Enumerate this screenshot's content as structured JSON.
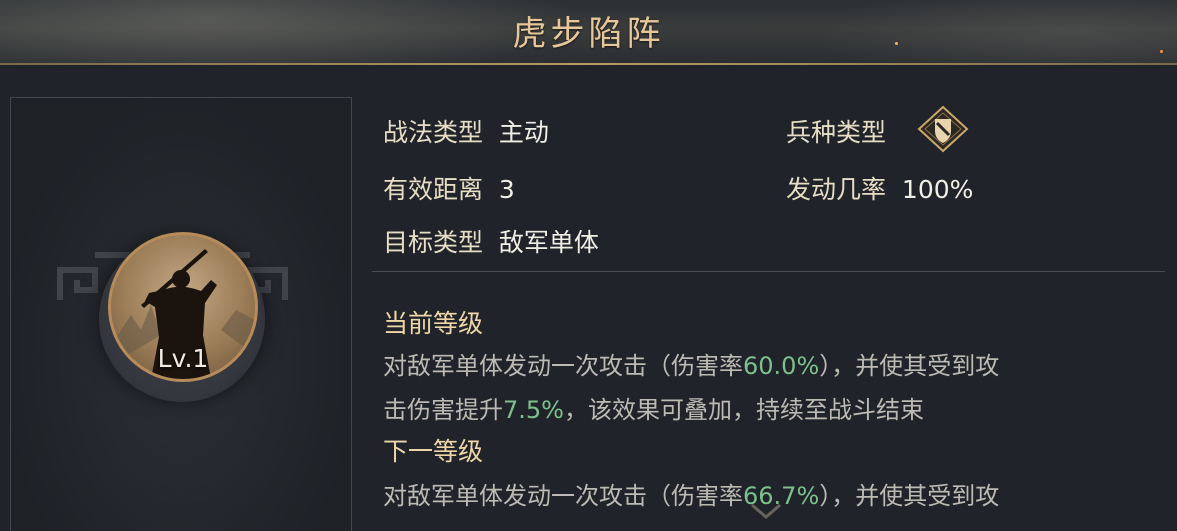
{
  "title": "虎步陷阵",
  "skill": {
    "level": "Lv.1",
    "type_label": "战法类型",
    "type_value": "主动",
    "troop_label": "兵种类型",
    "troop_icon": "shield-icon",
    "range_label": "有效距离",
    "range_value": "3",
    "rate_label": "发动几率",
    "rate_value": "100%",
    "target_label": "目标类型",
    "target_value": "敌军单体"
  },
  "current": {
    "heading": "当前等级",
    "line1_a": "对敌军单体发动一次攻击（伤害率",
    "line1_num": "60.0%",
    "line1_b": "），并使其受到攻",
    "line2_a": "击伤害提升",
    "line2_num": "7.5%",
    "line2_b": "，该效果可叠加，持续至战斗结束"
  },
  "next": {
    "heading": "下一等级",
    "line1_a": "对敌军单体发动一次攻击（伤害率",
    "line1_num": "66.7%",
    "line1_b": "），并使其受到攻"
  },
  "colors": {
    "accent_gold": "#e7c79a",
    "highlight_green": "#7cc08c"
  }
}
